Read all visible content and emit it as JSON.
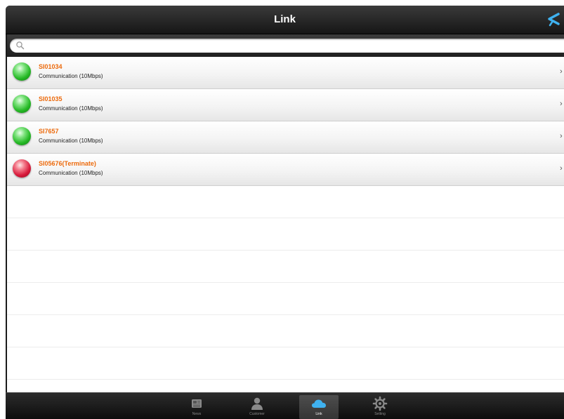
{
  "navbar": {
    "title": "Link",
    "action_icon": "back-arrow-icon"
  },
  "search": {
    "placeholder": "",
    "value": ""
  },
  "links": [
    {
      "name": "SI01034",
      "status": "Communication (10Mbps)",
      "state": "online",
      "color": "#2fc32f"
    },
    {
      "name": "SI01035",
      "status": "Communication (10Mbps)",
      "state": "online",
      "color": "#2fc32f"
    },
    {
      "name": "SI7657",
      "status": "Communication (10Mbps)",
      "state": "online",
      "color": "#2fc32f"
    },
    {
      "name": "SI05676(Terminate)",
      "status": "Communication (10Mbps)",
      "state": "terminated",
      "color": "#d7193a"
    }
  ],
  "tabbar": {
    "tabs": [
      {
        "label": "News",
        "icon": "news-icon",
        "selected": false
      },
      {
        "label": "Customer",
        "icon": "person-icon",
        "selected": false
      },
      {
        "label": "Link",
        "icon": "cloud-icon",
        "selected": true
      },
      {
        "label": "Setting",
        "icon": "gear-icon",
        "selected": false
      }
    ]
  },
  "colors": {
    "title_accent": "#ec6a0c",
    "cloud_blue": "#3fb2f0",
    "bar_dark": "#1b1b1b"
  }
}
